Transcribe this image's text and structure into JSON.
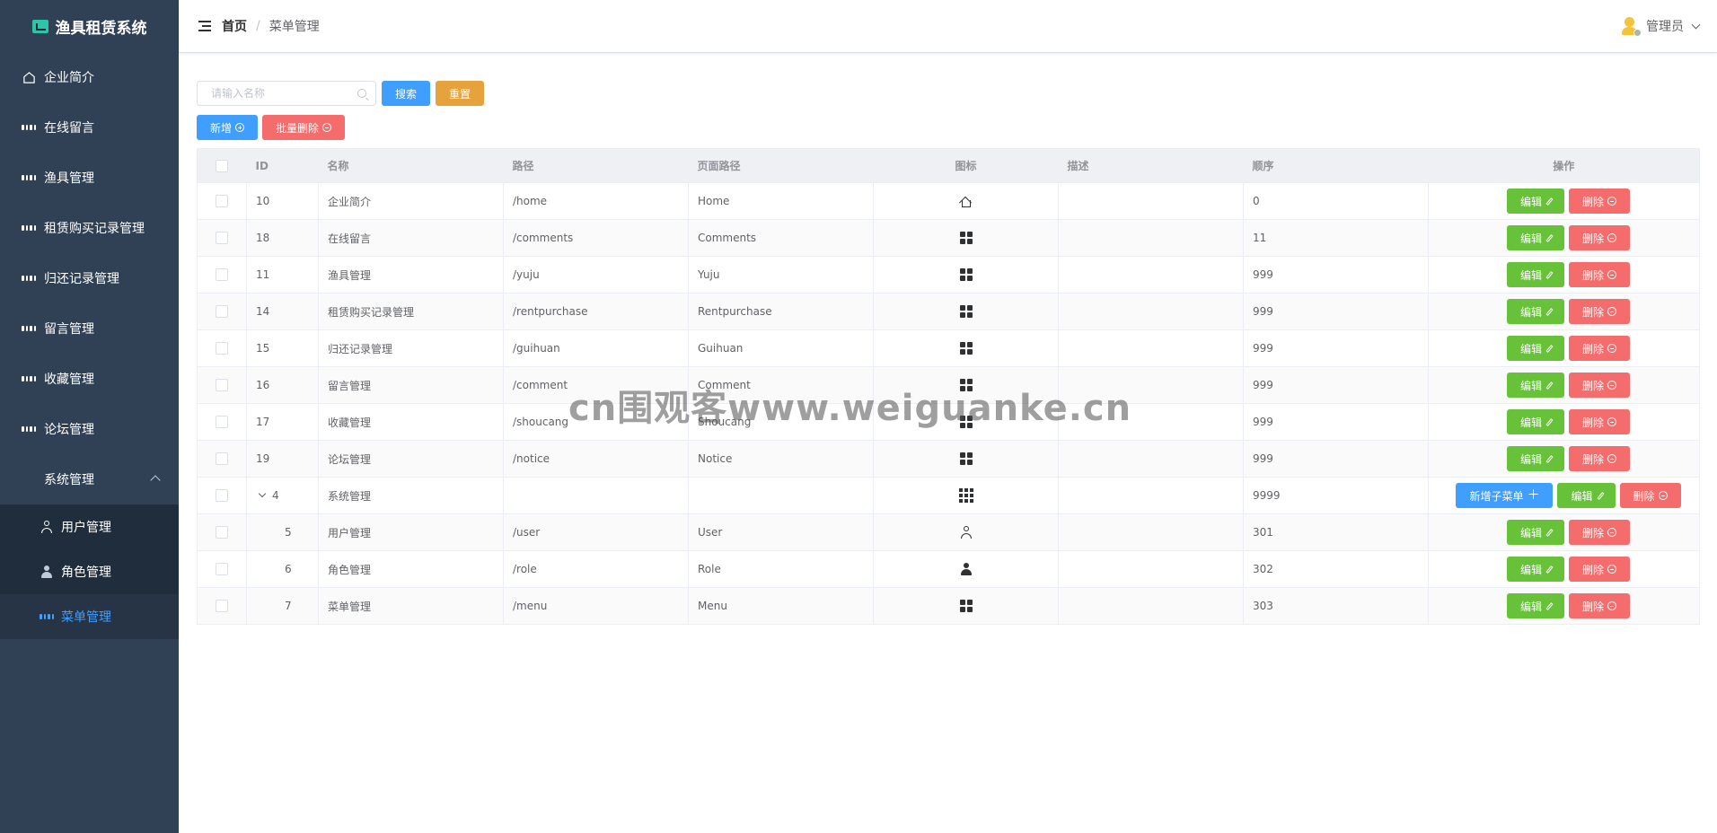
{
  "brand": {
    "title": "渔具租赁系统"
  },
  "sidebar": {
    "items": [
      {
        "label": "企业简介",
        "icon": "home-icon"
      },
      {
        "label": "在线留言",
        "icon": "grid-icon"
      },
      {
        "label": "渔具管理",
        "icon": "grid-icon"
      },
      {
        "label": "租赁购买记录管理",
        "icon": "grid-icon"
      },
      {
        "label": "归还记录管理",
        "icon": "grid-icon"
      },
      {
        "label": "留言管理",
        "icon": "grid-icon"
      },
      {
        "label": "收藏管理",
        "icon": "grid-icon"
      },
      {
        "label": "论坛管理",
        "icon": "grid-icon"
      },
      {
        "label": "系统管理",
        "icon": "grid9-icon",
        "expanded": true
      }
    ],
    "sub_items": [
      {
        "label": "用户管理",
        "icon": "user-icon"
      },
      {
        "label": "角色管理",
        "icon": "user-filled-icon"
      },
      {
        "label": "菜单管理",
        "icon": "grid-icon",
        "active": true
      }
    ]
  },
  "header": {
    "breadcrumb_home": "首页",
    "breadcrumb_sep": "/",
    "breadcrumb_current": "菜单管理",
    "user_name": "管理员"
  },
  "toolbar": {
    "search_placeholder": "请输入名称",
    "search_label": "搜索",
    "reset_label": "重置",
    "add_label": "新增",
    "batch_delete_label": "批量删除"
  },
  "table": {
    "columns": [
      "ID",
      "名称",
      "路径",
      "页面路径",
      "图标",
      "描述",
      "顺序",
      "操作"
    ],
    "edit_label": "编辑",
    "delete_label": "删除",
    "add_child_label": "新增子菜单",
    "rows": [
      {
        "id": "10",
        "name": "企业简介",
        "path": "/home",
        "page": "Home",
        "icon": "house-icon",
        "desc": "",
        "order": "0"
      },
      {
        "id": "18",
        "name": "在线留言",
        "path": "/comments",
        "page": "Comments",
        "icon": "grid-icon",
        "desc": "",
        "order": "11"
      },
      {
        "id": "11",
        "name": "渔具管理",
        "path": "/yuju",
        "page": "Yuju",
        "icon": "grid-icon",
        "desc": "",
        "order": "999"
      },
      {
        "id": "14",
        "name": "租赁购买记录管理",
        "path": "/rentpurchase",
        "page": "Rentpurchase",
        "icon": "grid-icon",
        "desc": "",
        "order": "999"
      },
      {
        "id": "15",
        "name": "归还记录管理",
        "path": "/guihuan",
        "page": "Guihuan",
        "icon": "grid-icon",
        "desc": "",
        "order": "999"
      },
      {
        "id": "16",
        "name": "留言管理",
        "path": "/comment",
        "page": "Comment",
        "icon": "grid-icon",
        "desc": "",
        "order": "999"
      },
      {
        "id": "17",
        "name": "收藏管理",
        "path": "/shoucang",
        "page": "Shoucang",
        "icon": "grid-icon",
        "desc": "",
        "order": "999"
      },
      {
        "id": "19",
        "name": "论坛管理",
        "path": "/notice",
        "page": "Notice",
        "icon": "grid-icon",
        "desc": "",
        "order": "999"
      },
      {
        "id": "4",
        "name": "系统管理",
        "path": "",
        "page": "",
        "icon": "grid9-icon",
        "desc": "",
        "order": "9999",
        "parent": true
      },
      {
        "id": "5",
        "name": "用户管理",
        "path": "/user",
        "page": "User",
        "icon": "user-icon",
        "desc": "",
        "order": "301",
        "child": true
      },
      {
        "id": "6",
        "name": "角色管理",
        "path": "/role",
        "page": "Role",
        "icon": "user-filled-icon",
        "desc": "",
        "order": "302",
        "child": true
      },
      {
        "id": "7",
        "name": "菜单管理",
        "path": "/menu",
        "page": "Menu",
        "icon": "grid-icon",
        "desc": "",
        "order": "303",
        "child": true
      }
    ]
  },
  "watermark": "cn围观客www.weiguanke.cn",
  "colors": {
    "sidebar": "#304156",
    "primary": "#409eff",
    "warning": "#e6a23c",
    "danger": "#f56c6c",
    "success": "#67c23a"
  }
}
